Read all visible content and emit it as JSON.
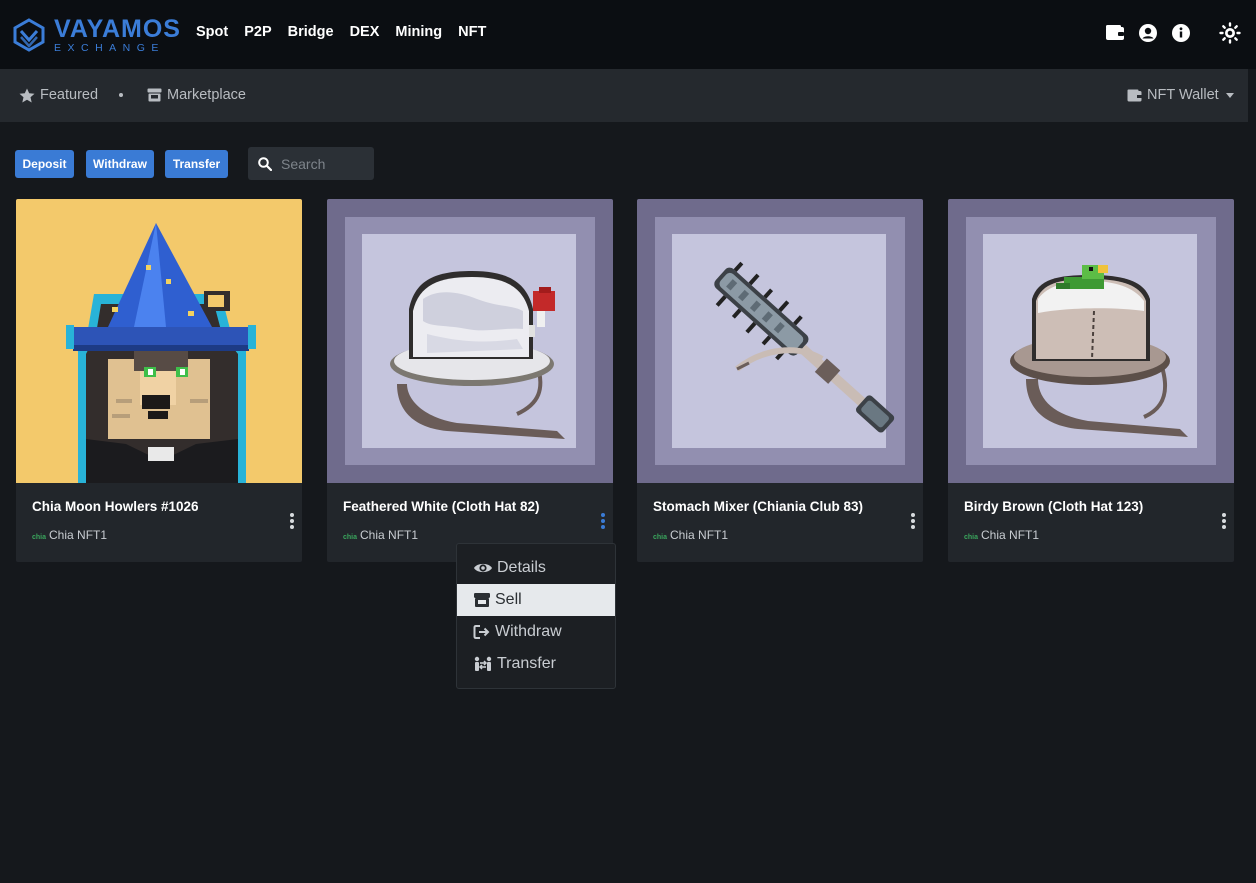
{
  "brand": {
    "name": "VAYAMOS",
    "tagline": "EXCHANGE",
    "color": "#3b7dd8"
  },
  "topnav": {
    "menu": [
      "Spot",
      "P2P",
      "Bridge",
      "DEX",
      "Mining",
      "NFT"
    ],
    "icons": [
      "wallet-icon",
      "user-circle-icon",
      "info-circle-icon",
      "sun-icon"
    ]
  },
  "subnav": {
    "featured": "Featured",
    "marketplace": "Marketplace",
    "wallet": "NFT Wallet"
  },
  "actions": {
    "deposit": "Deposit",
    "withdraw": "Withdraw",
    "transfer": "Transfer",
    "search_placeholder": "Search"
  },
  "cards": [
    {
      "title": "Chia Moon Howlers #1026",
      "chain_badge": "chia",
      "collection": "Chia NFT1"
    },
    {
      "title": "Feathered White (Cloth Hat 82)",
      "chain_badge": "chia",
      "collection": "Chia NFT1"
    },
    {
      "title": "Stomach Mixer (Chiania Club 83)",
      "chain_badge": "chia",
      "collection": "Chia NFT1"
    },
    {
      "title": "Birdy Brown (Cloth Hat 123)",
      "chain_badge": "chia",
      "collection": "Chia NFT1"
    }
  ],
  "context_menu": {
    "items": [
      "Details",
      "Sell",
      "Withdraw",
      "Transfer"
    ],
    "highlighted": "Sell"
  },
  "colors": {
    "accent": "#3a7bd5",
    "card_bg": "#22262b",
    "page_bg": "#15181c",
    "chia_green": "#3aa55d"
  }
}
